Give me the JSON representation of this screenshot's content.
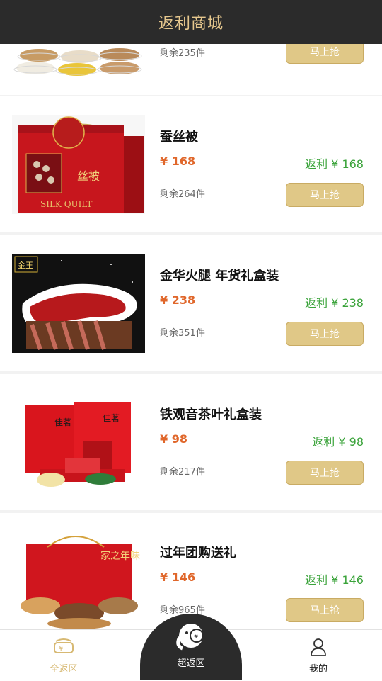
{
  "header": {
    "title": "返利商城"
  },
  "products": [
    {
      "stock": "剩余235件",
      "buy_label": "马上抢",
      "icon": "grain-bowls-image"
    },
    {
      "name": "蚕丝被",
      "price": "¥ 168",
      "cashback": "返利 ¥ 168",
      "stock": "剩余264件",
      "buy_label": "马上抢",
      "image_text": "丝被",
      "icon": "silk-quilt-box-image"
    },
    {
      "name": "金华火腿 年货礼盒装",
      "price": "¥ 238",
      "cashback": "返利 ¥ 238",
      "stock": "剩余351件",
      "buy_label": "马上抢",
      "image_text": "金王",
      "icon": "ham-giftbox-image"
    },
    {
      "name": "铁观音茶叶礼盒装",
      "price": "¥ 98",
      "cashback": "返利 ¥ 98",
      "stock": "剩余217件",
      "buy_label": "马上抢",
      "image_text": "佳茗",
      "icon": "tea-giftbox-image"
    },
    {
      "name": "过年团购送礼",
      "price": "¥ 146",
      "cashback": "返利 ¥ 146",
      "stock": "剩余965件",
      "buy_label": "马上抢",
      "image_text": "家之年味",
      "icon": "nuts-giftbox-image"
    }
  ],
  "tabbar": {
    "left_label": "全返区",
    "center_label": "超返区",
    "right_label": "我的"
  },
  "colors": {
    "header_bg": "#2b2b2b",
    "header_text": "#e6c78d",
    "price": "#e0672b",
    "cashback": "#3aa33a",
    "button": "#e0c887"
  }
}
